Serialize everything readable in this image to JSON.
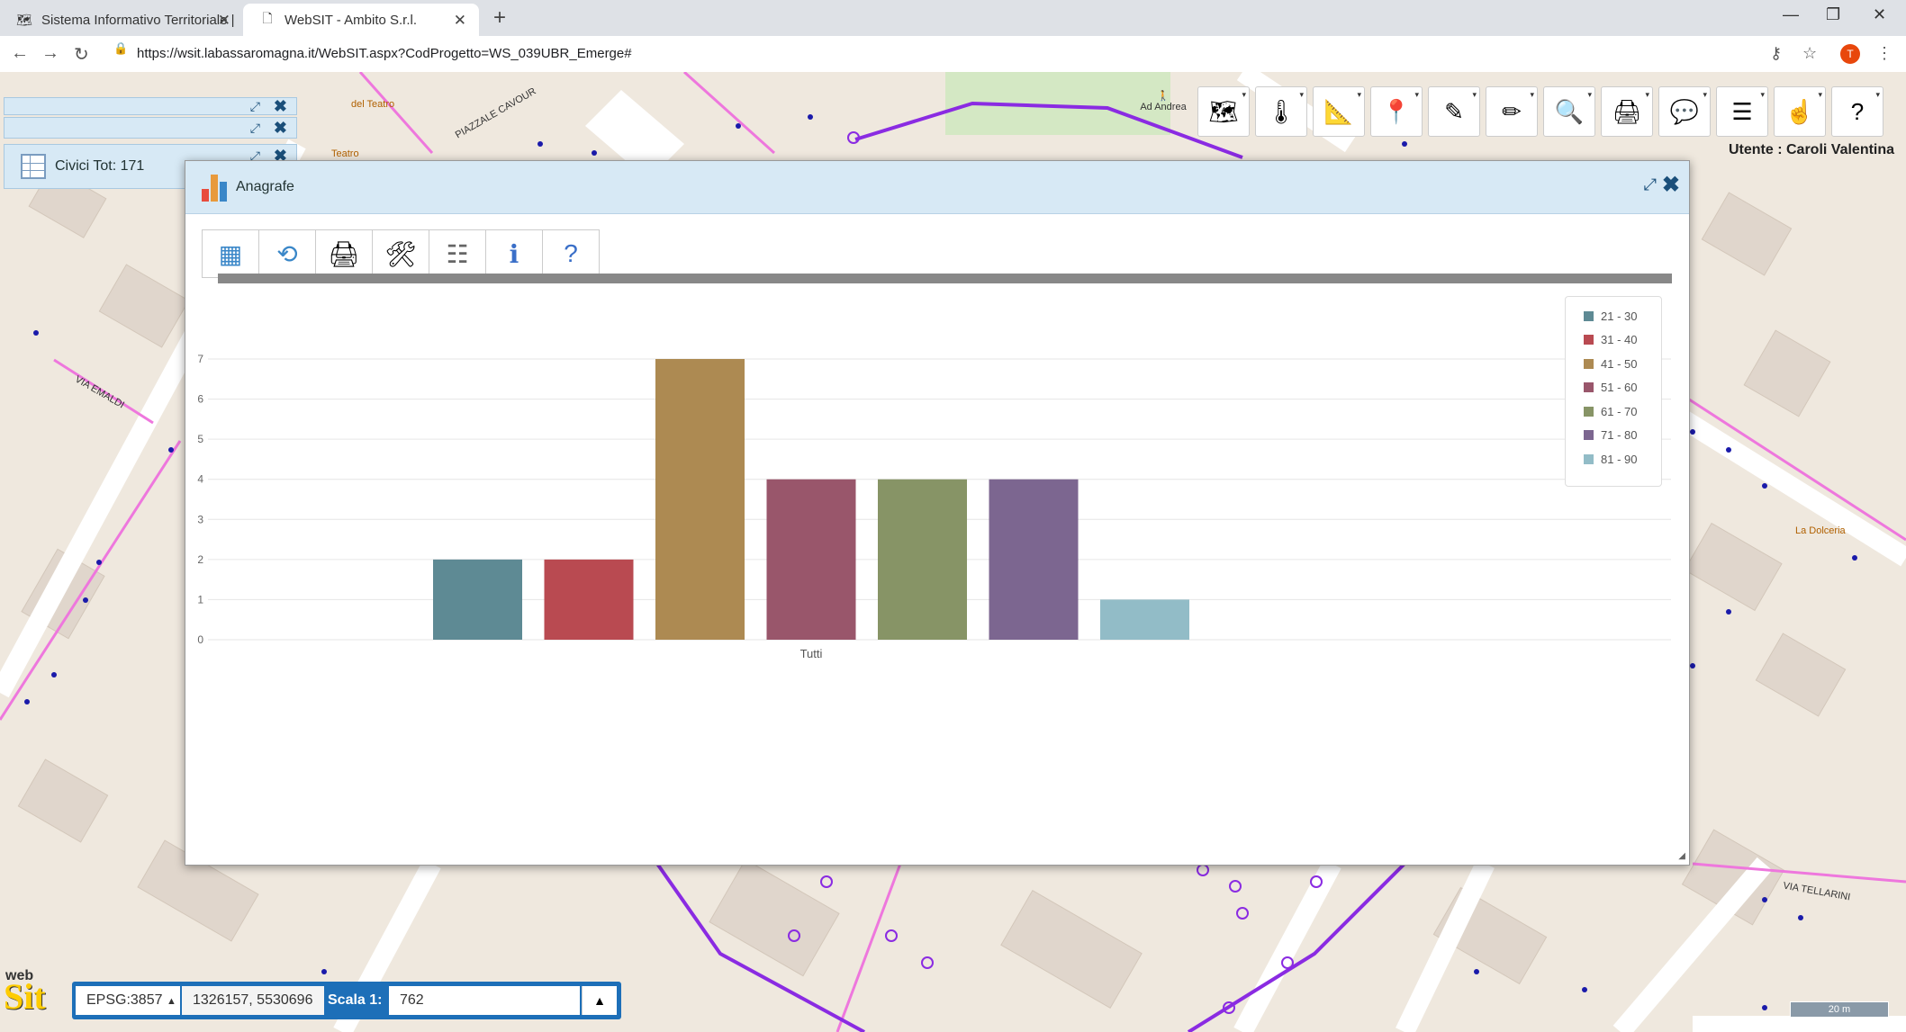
{
  "browser": {
    "tabs": [
      {
        "label": "Sistema Informativo Territoriale |"
      },
      {
        "label": "WebSIT - Ambito S.r.l."
      }
    ],
    "url": "https://wsit.labassaromagna.it/WebSIT.aspx?CodProgetto=WS_039UBR_Emerge#",
    "avatar_letter": "T"
  },
  "map": {
    "user_label": "Utente : Caroli Valentina",
    "toolbar_marker_label": "Ad Andrea",
    "street_labels": [
      "VIA EMALDI",
      "PIAZZALE CAVOUR",
      "La Dolceria",
      "Teatro",
      "del Teatro",
      "VIA TELLARINI"
    ],
    "toolbar_buttons": [
      {
        "icon": "map-layers-icon"
      },
      {
        "icon": "thermometer-icon"
      },
      {
        "icon": "measure-icon"
      },
      {
        "icon": "location-pin-icon"
      },
      {
        "icon": "draw-icon"
      },
      {
        "icon": "edit-draw-icon"
      },
      {
        "icon": "zoom-search-icon"
      },
      {
        "icon": "print-icon"
      },
      {
        "icon": "comment-icon"
      },
      {
        "icon": "layer-list-icon"
      },
      {
        "icon": "identify-icon"
      },
      {
        "icon": "help-icon"
      }
    ]
  },
  "panels": {
    "civici": {
      "label": "Civici Tot: 171"
    }
  },
  "dialog": {
    "title": "Anagrafe",
    "tools": [
      {
        "icon": "table-icon"
      },
      {
        "icon": "refresh-icon"
      },
      {
        "icon": "print-icon"
      },
      {
        "icon": "settings-icon"
      },
      {
        "icon": "list-icon"
      },
      {
        "icon": "info-icon"
      },
      {
        "icon": "help-icon"
      }
    ]
  },
  "chart_data": {
    "type": "bar",
    "categories": [
      "Tutti"
    ],
    "series": [
      {
        "name": "21 - 30",
        "values": [
          2
        ],
        "color": "#5e8a94"
      },
      {
        "name": "31 - 40",
        "values": [
          2
        ],
        "color": "#b94a51"
      },
      {
        "name": "41 - 50",
        "values": [
          7
        ],
        "color": "#ad8a52"
      },
      {
        "name": "51 - 60",
        "values": [
          4
        ],
        "color": "#99566b"
      },
      {
        "name": "61 - 70",
        "values": [
          4
        ],
        "color": "#879466"
      },
      {
        "name": "71 - 80",
        "values": [
          4
        ],
        "color": "#7c6690"
      },
      {
        "name": "81 - 90",
        "values": [
          1
        ],
        "color": "#92bcc7"
      }
    ],
    "ylim": [
      0,
      7
    ],
    "yticks": [
      "0",
      "1",
      "2",
      "3",
      "4",
      "5",
      "6",
      "7"
    ],
    "grid": true,
    "legend_position": "top-right"
  },
  "status": {
    "epsg": "EPSG:3857",
    "coords": "1326157, 5530696",
    "scale_label": "Scala 1:",
    "scale_value": "762",
    "scalebar_label": "20 m",
    "logo_top": "web",
    "logo_main": "Sit"
  }
}
